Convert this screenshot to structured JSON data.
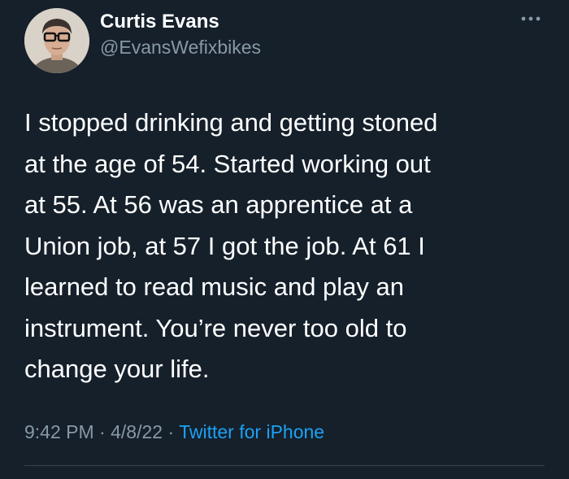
{
  "user": {
    "display_name": "Curtis Evans",
    "handle": "@EvansWefixbikes",
    "avatar_icon": "profile-photo"
  },
  "tweet": {
    "lines": [
      "I stopped drinking and getting stoned",
      "at the age of 54.  Started working out",
      "at 55.  At 56 was an apprentice at a",
      "Union job, at 57 I got the job. At 61 I",
      "learned to read music and play an",
      "instrument. You’re never too old to",
      "change your life."
    ],
    "time": "9:42 PM",
    "date": "4/8/22",
    "separator": "·",
    "source": "Twitter for iPhone"
  },
  "colors": {
    "background": "#15202b",
    "text": "#ffffff",
    "secondary": "#8899a6",
    "link": "#1da1f2"
  }
}
